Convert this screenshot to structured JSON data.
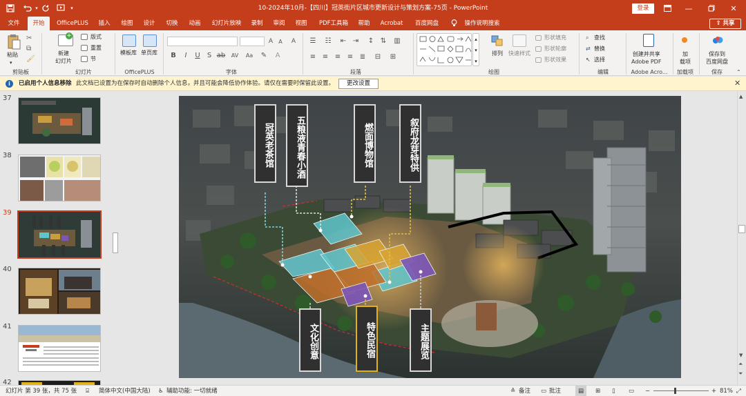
{
  "window": {
    "title": "10-2024年10月-【四川】冠英街片区城市更新设计与策划方案-75页  -  PowerPoint",
    "login": "登录"
  },
  "menu": {
    "items": [
      "文件",
      "开始",
      "OfficePLUS",
      "插入",
      "绘图",
      "设计",
      "切换",
      "动画",
      "幻灯片放映",
      "录制",
      "审阅",
      "视图",
      "PDF工具箱",
      "帮助",
      "Acrobat",
      "百度网盘"
    ],
    "search": "操作说明搜索",
    "share": "共享"
  },
  "ribbon": {
    "clipboard": {
      "paste": "粘贴",
      "label": "剪贴板"
    },
    "slides": {
      "new_slide": "新建\n幻灯片",
      "layout": "版式",
      "reset": "重置",
      "section": "节",
      "label": "幻灯片"
    },
    "officeplus": {
      "template": "模板库",
      "single": "单页库",
      "label": "OfficePLUS"
    },
    "font": {
      "bold": "B",
      "italic": "I",
      "underline": "U",
      "strike": "S",
      "label": "字体"
    },
    "paragraph": {
      "label": "段落"
    },
    "drawing": {
      "arrange": "排列",
      "quick_styles": "快速样式",
      "fill": "形状填充",
      "outline": "形状轮廓",
      "effect": "形状效果",
      "label": "绘图"
    },
    "editing": {
      "find": "查找",
      "replace": "替换",
      "select": "选择",
      "label": "编辑"
    },
    "adobe": {
      "create": "创建并共享\nAdobe PDF",
      "label": "Adobe Acro..."
    },
    "addins": {
      "addins": "加\n载项",
      "label": "加载项"
    },
    "save": {
      "save_baidu": "保存到\n百度网盘",
      "label": "保存"
    }
  },
  "infobar": {
    "title": "已启用个人信息移除",
    "message": "此文档已设置为在保存时自动删除个人信息，并且可能会降低协作体验。请仅在需要时保留此设置。",
    "button": "更改设置"
  },
  "thumbnails": [
    {
      "num": "37",
      "active": false
    },
    {
      "num": "38",
      "active": false
    },
    {
      "num": "39",
      "active": true
    },
    {
      "num": "40",
      "active": false
    },
    {
      "num": "41",
      "active": false
    },
    {
      "num": "42",
      "active": false
    }
  ],
  "slide": {
    "labels_top": [
      "冠英老茶馆",
      "五粮液青春小酒",
      "燃面博物馆",
      "叙府龙芽特供"
    ],
    "labels_bottom": [
      "文化创意",
      "特色民宿",
      "主题展览"
    ]
  },
  "statusbar": {
    "slide_info": "幻灯片 第 39 张，共 75 张",
    "language": "简体中文(中国大陆)",
    "accessibility": "辅助功能: 一切就绪",
    "notes": "备注",
    "comments": "批注",
    "zoom": "81%"
  },
  "colors": {
    "accent": "#c43e1c",
    "info_bg": "#fff4ce"
  }
}
